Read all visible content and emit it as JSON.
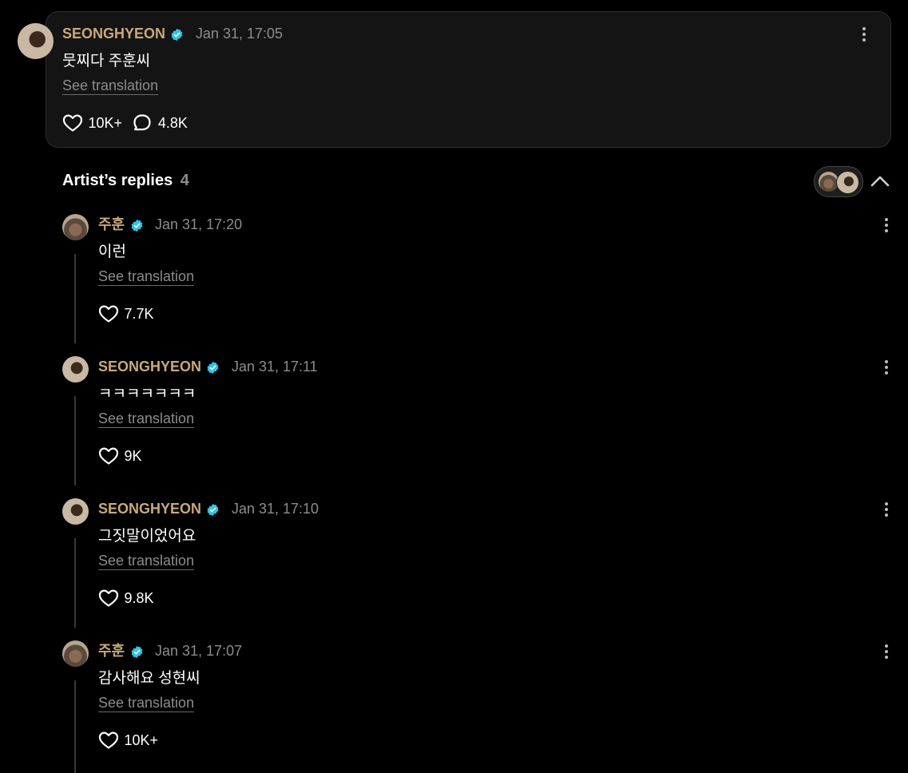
{
  "top_post": {
    "author": "SEONGHYEON",
    "date": "Jan 31, 17:05",
    "text": "뭇찌다 주훈씨",
    "see_translation": "See translation",
    "likes": "10K+",
    "comments": "4.8K"
  },
  "replies_header": {
    "title": "Artist’s replies",
    "count": "4"
  },
  "replies": [
    {
      "author": "주훈",
      "date": "Jan 31, 17:20",
      "text": "이런",
      "see_translation": "See translation",
      "likes": "7.7K"
    },
    {
      "author": "SEONGHYEON",
      "date": "Jan 31, 17:11",
      "text": "ㅋㅋㅋㅋㅋㅋㅋ",
      "see_translation": "See translation",
      "likes": "9K"
    },
    {
      "author": "SEONGHYEON",
      "date": "Jan 31, 17:10",
      "text": "그짓말이었어요",
      "see_translation": "See translation",
      "likes": "9.8K"
    },
    {
      "author": "주훈",
      "date": "Jan 31, 17:07",
      "text": "감사해요 성현씨",
      "see_translation": "See translation",
      "likes": "10K+"
    }
  ],
  "colors": {
    "background": "#000000",
    "card": "#141414",
    "name": "#c9a97a",
    "verified": "#31c4e8",
    "muted": "#8c8c8c"
  },
  "icons": [
    "verified-icon",
    "more-icon",
    "heart-icon",
    "comment-icon",
    "chevron-up-icon"
  ]
}
